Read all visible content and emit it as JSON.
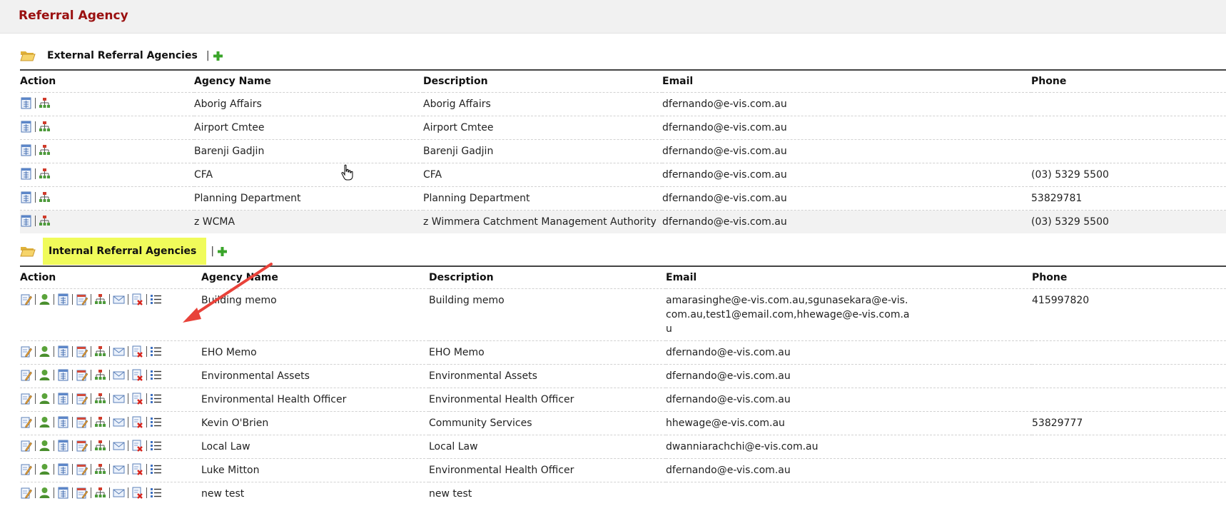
{
  "page": {
    "title": "Referral Agency"
  },
  "external": {
    "title": "External Referral Agencies",
    "columns": [
      "Action",
      "Agency Name",
      "Description",
      "Email",
      "Phone"
    ],
    "rows": [
      {
        "name": "Aborig Affairs",
        "description": "Aborig Affairs",
        "email": "dfernando@e-vis.com.au",
        "phone": ""
      },
      {
        "name": "Airport Cmtee",
        "description": "Airport Cmtee",
        "email": "dfernando@e-vis.com.au",
        "phone": ""
      },
      {
        "name": "Barenji Gadjin",
        "description": "Barenji Gadjin",
        "email": "dfernando@e-vis.com.au",
        "phone": ""
      },
      {
        "name": "CFA",
        "description": "CFA",
        "email": "dfernando@e-vis.com.au",
        "phone": "(03) 5329 5500"
      },
      {
        "name": "Planning Department",
        "description": "Planning Department",
        "email": "dfernando@e-vis.com.au",
        "phone": "53829781"
      },
      {
        "name": "z WCMA",
        "description": "z Wimmera Catchment Management Authority",
        "email": "dfernando@e-vis.com.au",
        "phone": "(03) 5329 5500"
      }
    ]
  },
  "internal": {
    "title": "Internal Referral Agencies",
    "columns": [
      "Action",
      "Agency Name",
      "Description",
      "Email",
      "Phone"
    ],
    "rows": [
      {
        "name": "Building memo",
        "description": "Building memo",
        "email": "amarasinghe@e-vis.com.au,sgunasekara@e-vis.com.au,test1@email.com,hhewage@e-vis.com.au",
        "phone": "415997820"
      },
      {
        "name": "EHO Memo",
        "description": "EHO Memo",
        "email": "dfernando@e-vis.com.au",
        "phone": ""
      },
      {
        "name": "Environmental Assets",
        "description": "Environmental Assets",
        "email": "dfernando@e-vis.com.au",
        "phone": ""
      },
      {
        "name": "Environmental Health Officer",
        "description": "Environmental Health Officer",
        "email": "dfernando@e-vis.com.au",
        "phone": ""
      },
      {
        "name": "Kevin O'Brien",
        "description": "Community Services",
        "email": "hhewage@e-vis.com.au",
        "phone": "53829777"
      },
      {
        "name": "Local Law",
        "description": "Local Law",
        "email": "dwanniarachchi@e-vis.com.au",
        "phone": ""
      },
      {
        "name": "Luke Mitton",
        "description": "Environmental Health Officer",
        "email": "dfernando@e-vis.com.au",
        "phone": ""
      },
      {
        "name": "new test",
        "description": "new test",
        "email": "",
        "phone": ""
      }
    ]
  },
  "icons": {
    "section": "folder-open-icon",
    "add": "plus-icon",
    "external_actions": [
      "details-icon",
      "hierarchy-icon"
    ],
    "internal_actions": [
      "edit-icon",
      "user-icon",
      "details-icon",
      "edit-form-icon",
      "hierarchy-icon",
      "email-icon",
      "delete-icon",
      "list-icon"
    ]
  },
  "colors": {
    "title": "#9a1010",
    "highlight": "#f0fb5a",
    "annotation_arrow": "#e8423a",
    "add_icon": "#3aa52a"
  }
}
